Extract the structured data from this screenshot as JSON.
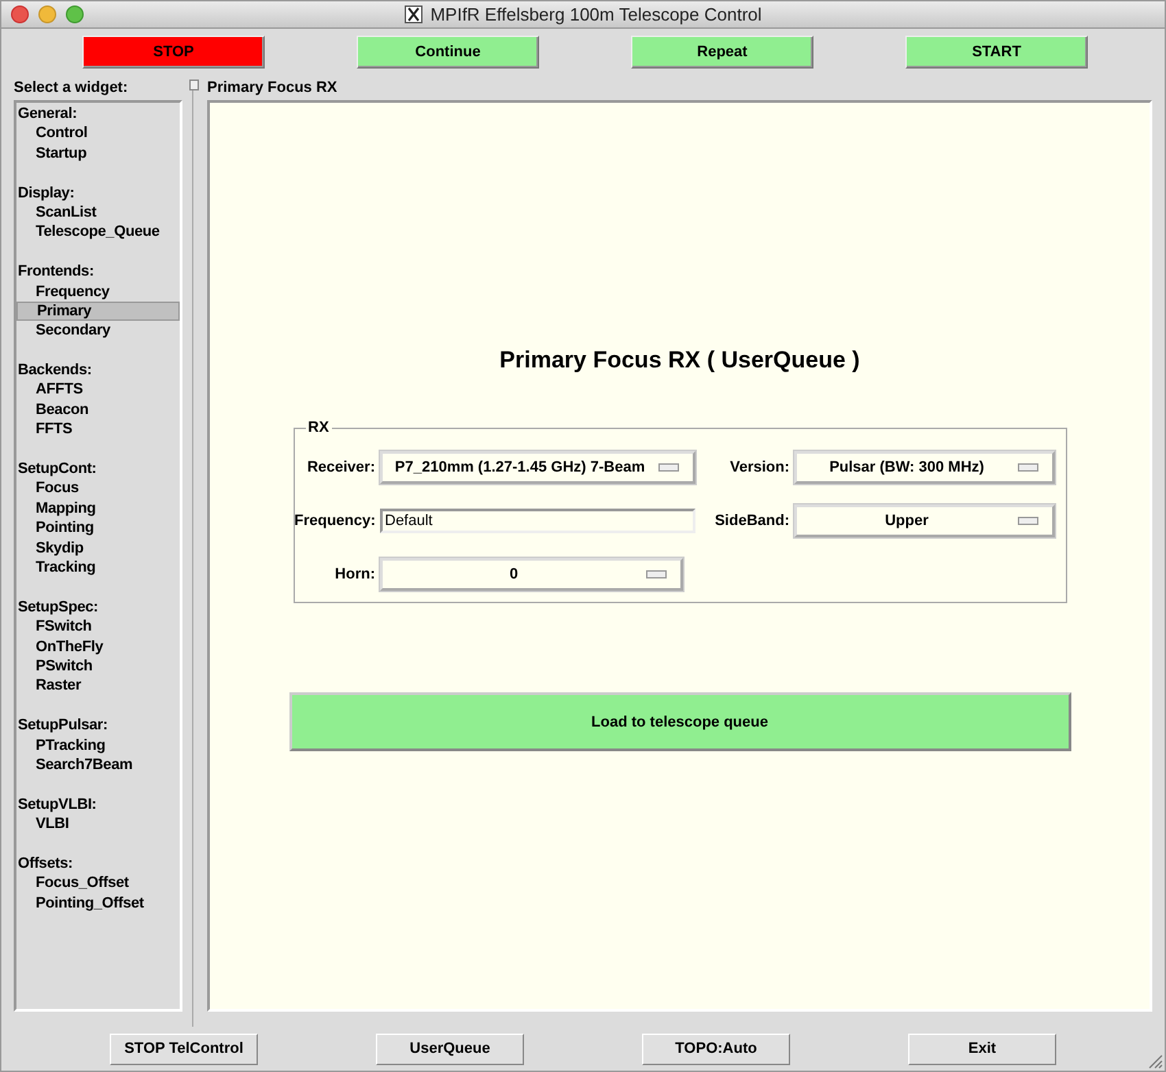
{
  "window": {
    "title": "MPIfR Effelsberg 100m Telescope Control"
  },
  "top_buttons": [
    {
      "label": "STOP",
      "color": "#ff0000"
    },
    {
      "label": "Continue",
      "color": "#90ee90"
    },
    {
      "label": "Repeat",
      "color": "#90ee90"
    },
    {
      "label": "START",
      "color": "#90ee90"
    }
  ],
  "sidebar": {
    "heading": "Select a widget:",
    "groups": [
      {
        "label": "General:",
        "children": [
          {
            "label": "Control",
            "selected": false
          },
          {
            "label": "Startup",
            "selected": false
          }
        ]
      },
      {
        "label": "Display:",
        "children": [
          {
            "label": "ScanList",
            "selected": false
          },
          {
            "label": "Telescope_Queue",
            "selected": false
          }
        ]
      },
      {
        "label": "Frontends:",
        "children": [
          {
            "label": "Frequency",
            "selected": false
          },
          {
            "label": "Primary",
            "selected": true
          },
          {
            "label": "Secondary",
            "selected": false
          }
        ]
      },
      {
        "label": "Backends:",
        "children": [
          {
            "label": "AFFTS",
            "selected": false
          },
          {
            "label": "Beacon",
            "selected": false
          },
          {
            "label": "FFTS",
            "selected": false
          }
        ]
      },
      {
        "label": "SetupCont:",
        "children": [
          {
            "label": "Focus",
            "selected": false
          },
          {
            "label": "Mapping",
            "selected": false
          },
          {
            "label": "Pointing",
            "selected": false
          },
          {
            "label": "Skydip",
            "selected": false
          },
          {
            "label": "Tracking",
            "selected": false
          }
        ]
      },
      {
        "label": "SetupSpec:",
        "children": [
          {
            "label": "FSwitch",
            "selected": false
          },
          {
            "label": "OnTheFly",
            "selected": false
          },
          {
            "label": "PSwitch",
            "selected": false
          },
          {
            "label": "Raster",
            "selected": false
          }
        ]
      },
      {
        "label": "SetupPulsar:",
        "children": [
          {
            "label": "PTracking",
            "selected": false
          },
          {
            "label": "Search7Beam",
            "selected": false
          }
        ]
      },
      {
        "label": "SetupVLBI:",
        "children": [
          {
            "label": "VLBI",
            "selected": false
          }
        ]
      },
      {
        "label": "Offsets:",
        "children": [
          {
            "label": "Focus_Offset",
            "selected": false
          },
          {
            "label": "Pointing_Offset",
            "selected": false
          }
        ]
      }
    ]
  },
  "panel": {
    "header": "Primary Focus RX",
    "title": "Primary Focus RX ( UserQueue )",
    "group": {
      "legend": "RX",
      "rows": [
        [
          {
            "label": "Receiver:",
            "kind": "dropdown",
            "value": "P7_210mm (1.27-1.45 GHz) 7-Beam"
          },
          {
            "label": "Version:",
            "kind": "dropdown",
            "value": "Pulsar (BW: 300 MHz)"
          }
        ],
        [
          {
            "label": "Frequency:",
            "kind": "text",
            "value": "Default"
          },
          {
            "label": "SideBand:",
            "kind": "dropdown",
            "value": "Upper"
          }
        ],
        [
          {
            "label": "Horn:",
            "kind": "dropdown",
            "value": "0"
          }
        ]
      ]
    },
    "action": "Load to telescope queue"
  },
  "bottom_buttons": [
    "STOP TelControl",
    "UserQueue",
    "TOPO:Auto",
    "Exit"
  ]
}
